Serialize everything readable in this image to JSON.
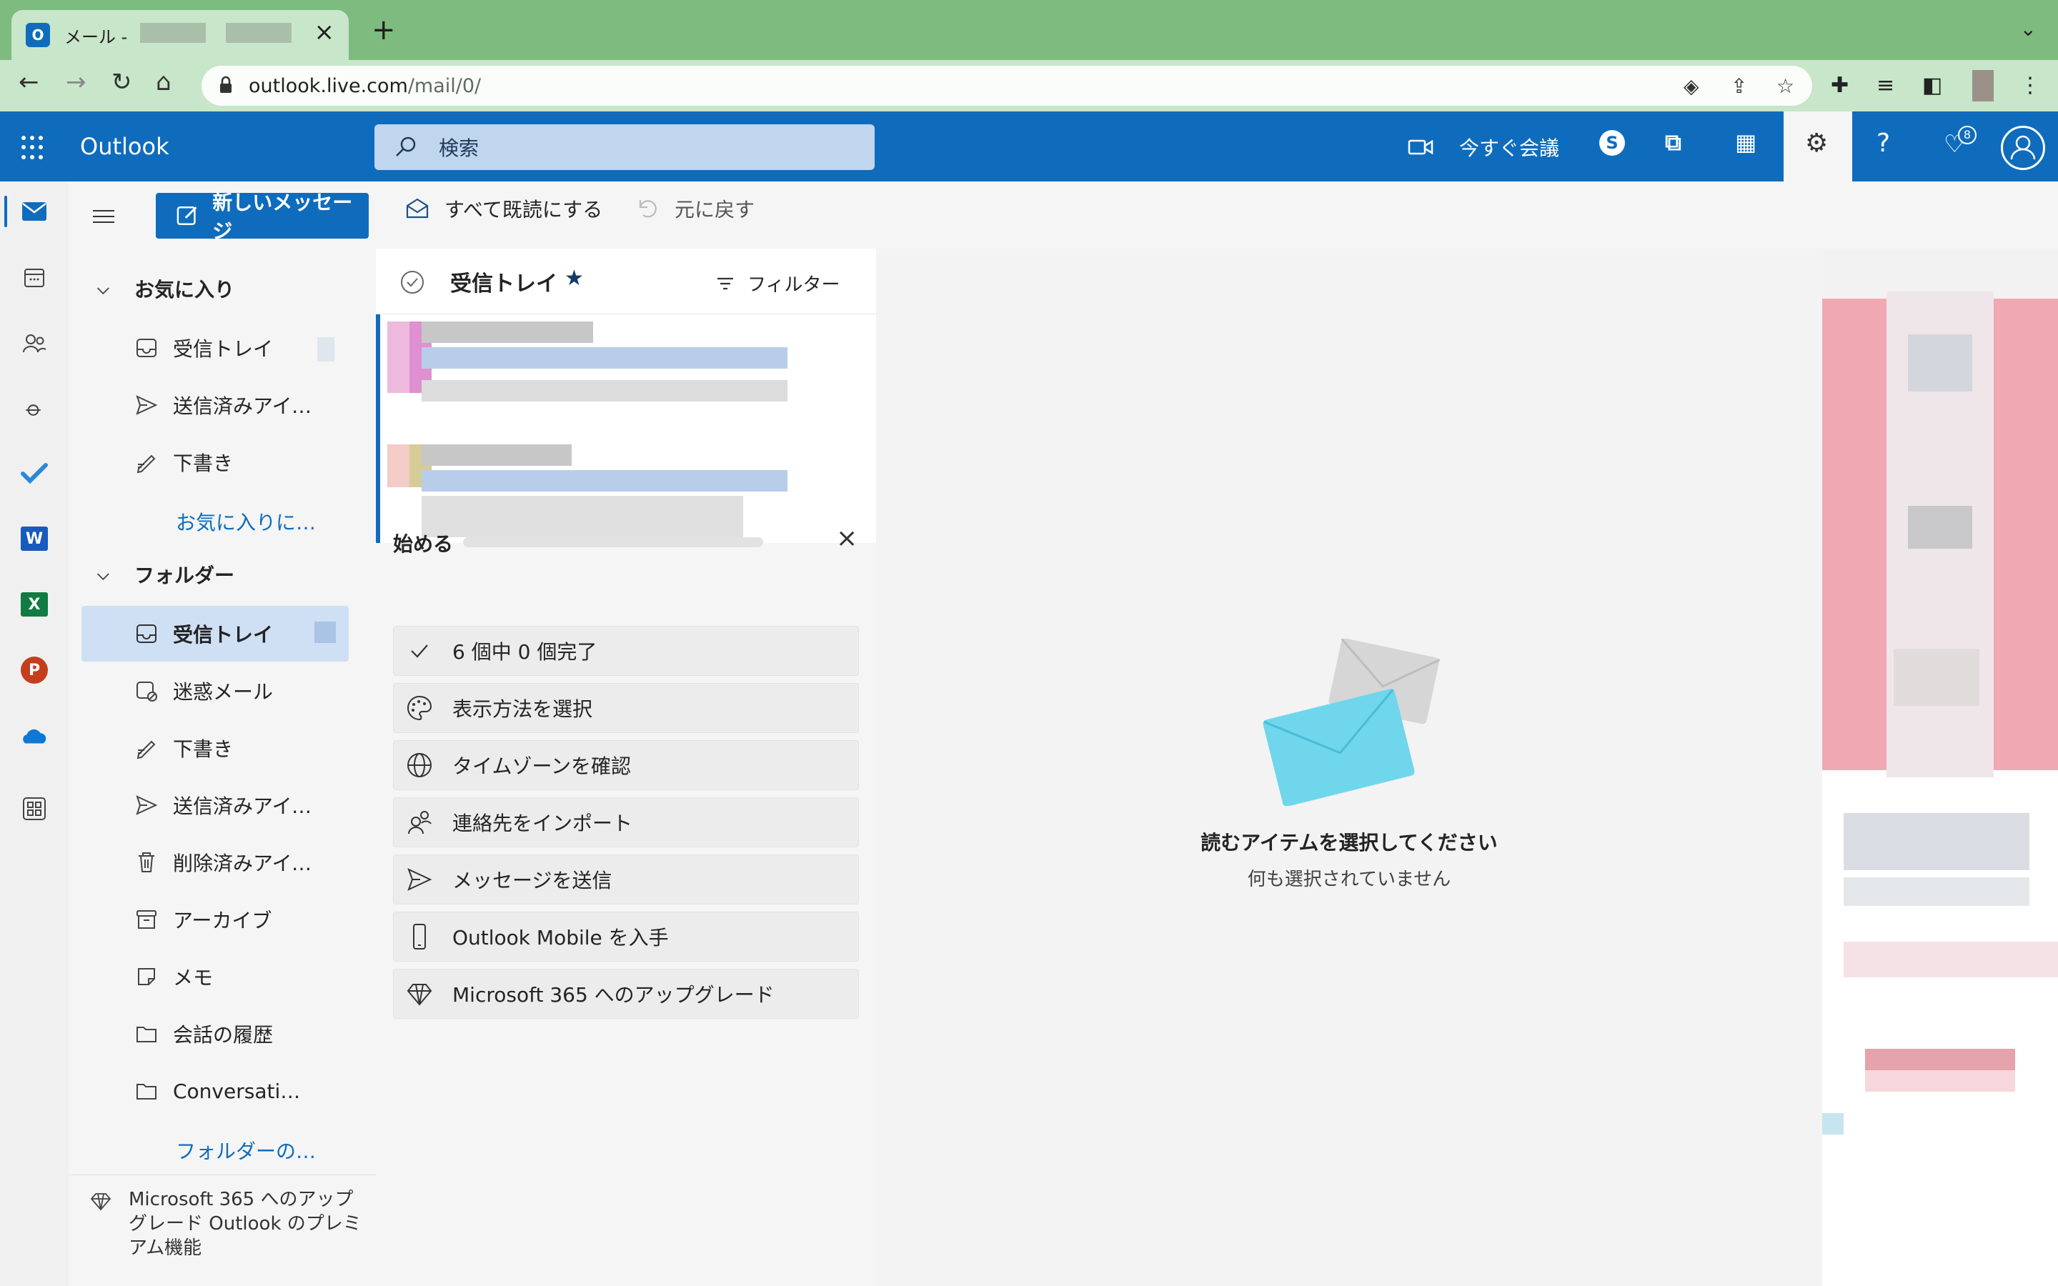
{
  "browser": {
    "tab_title": "メール - ",
    "tab_favicon": "O",
    "url_host": "outlook.live.com",
    "url_path": "/mail/0/"
  },
  "header": {
    "app_name": "Outlook",
    "search_placeholder": "検索",
    "meet_now": "今すぐ会議",
    "notification_count": "8"
  },
  "commands": {
    "new_message": "新しいメッセージ",
    "mark_all_read": "すべて既読にする",
    "undo": "元に戻す"
  },
  "folder_pane": {
    "favorites_header": "お気に入り",
    "favorites": [
      {
        "label": "受信トレイ",
        "icon": "inbox-icon"
      },
      {
        "label": "送信済みアイテム",
        "icon": "send-icon"
      },
      {
        "label": "下書き",
        "icon": "draft-icon"
      }
    ],
    "add_favorite_link": "お気に入りに…",
    "folders_header": "フォルダー",
    "folders": [
      {
        "label": "受信トレイ",
        "icon": "inbox-icon",
        "selected": true
      },
      {
        "label": "迷惑メール",
        "icon": "junk-icon"
      },
      {
        "label": "下書き",
        "icon": "draft-icon"
      },
      {
        "label": "送信済みアイテム",
        "icon": "send-icon"
      },
      {
        "label": "削除済みアイテム",
        "icon": "trash-icon"
      },
      {
        "label": "アーカイブ",
        "icon": "archive-icon"
      },
      {
        "label": "メモ",
        "icon": "note-icon"
      },
      {
        "label": "会話の履歴",
        "icon": "folder-icon"
      },
      {
        "label": "Conversation History",
        "icon": "folder-icon"
      }
    ],
    "create_folder_link": "フォルダーの…",
    "upgrade_text": "Microsoft 365 へのアップグレード Outlook のプレミアム機能"
  },
  "message_list": {
    "title": "受信トレイ",
    "filter_label": "フィルター"
  },
  "getting_started": {
    "title": "始める",
    "progress": 0,
    "items": [
      {
        "label": "6 個中 0 個完了",
        "icon": "check-icon"
      },
      {
        "label": "表示方法を選択",
        "icon": "palette-icon"
      },
      {
        "label": "タイムゾーンを確認",
        "icon": "globe-icon"
      },
      {
        "label": "連絡先をインポート",
        "icon": "people-icon"
      },
      {
        "label": "メッセージを送信",
        "icon": "send-icon"
      },
      {
        "label": "Outlook Mobile を入手",
        "icon": "phone-icon"
      },
      {
        "label": "Microsoft 365 へのアップグレード",
        "icon": "diamond-icon"
      }
    ]
  },
  "reading_pane": {
    "empty_title": "読むアイテムを選択してください",
    "empty_subtitle": "何も選択されていません"
  },
  "colors": {
    "brand": "#0f6cbd",
    "chrome_green": "#7dbc7e",
    "selected_folder": "#cfe0f5"
  }
}
